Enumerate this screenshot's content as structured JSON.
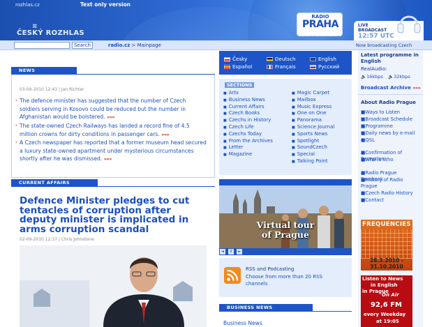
{
  "header": {
    "top_link": "rozhlas.cz",
    "text_only": "Text only version",
    "logo_text": "ČESKÝ ROZHLAS",
    "rp_line1": "RADIO",
    "rp_line2": "PRAHA",
    "rp_sub": "ČESKÝ ROZHLAS 7",
    "live_line1": "LIVE",
    "live_line2": "BROADCAST",
    "live_time": "12:57 UTC"
  },
  "search": {
    "button": "Search",
    "breadcrumb_home": "radio.cz",
    "breadcrumb_sep": ">",
    "breadcrumb_current": "Mainpage",
    "now_broadcasting": "Now broadcasting Czech"
  },
  "news": {
    "header": "NEWS",
    "meta_date": "03-09-2010 12:43",
    "meta_author": "Jan Richter",
    "more": "»»»",
    "items": [
      "The defence minister has suggested that the number of Czech soldiers serving in Kosovo could be reduced but the number in Afghanistan would be bolstered.",
      "The state-owned Czech Railways has landed a record fine of 4.5 million crowns for dirty conditions in passenger cars.",
      "A Czech newspaper has reported that a former museum head secured a luxury state-owned apartment under mysterious circumstances shortly after he was dismissed."
    ]
  },
  "current_affairs": {
    "header": "CURRENT AFFAIRS",
    "title": "Defence Minister pledges to cut tentacles of corruption after deputy minister is implicated in arms corruption scandal",
    "meta_date": "02-09-2010 12:37",
    "meta_author": "Chris Johnstone"
  },
  "languages": {
    "cesky": "Česky",
    "espanol": "Español",
    "deutsch": "Deutsch",
    "francais": "Français",
    "english": "English",
    "russian": "Русский"
  },
  "sections": {
    "header": "SECTIONS",
    "col1": [
      "Arts",
      "Business News",
      "Current Affairs",
      "Czech Books",
      "Czechs in History",
      "Czech Life",
      "Czechs Today",
      "From the Archives",
      "Letter",
      "Magazine"
    ],
    "col2": [
      "Magic Carpet",
      "Mailbox",
      "Music Express",
      "One on One",
      "Panorama",
      "Science Journal",
      "Sports News",
      "Spotlight",
      "SoundCzech",
      "Special",
      "Talking Point"
    ]
  },
  "virtual_tour": {
    "line1": "Virtual tour",
    "line2": "of Prague",
    "prev": "◄",
    "pause": "II",
    "next": "►"
  },
  "rss": {
    "title": "RSS and Podcasting",
    "desc": "Choose from more than 20 RSS channels"
  },
  "business_news": {
    "header": "BUSINESS NEWS",
    "link": "Business News"
  },
  "right": {
    "latest_title": "Latest programme in English",
    "realaudio": "RealAudio:",
    "kbps16": "16kbps",
    "kbps32": "32kbps",
    "archive": "Broadcast Archive",
    "archive_more": "»»»",
    "about_title": "About Radio Prague",
    "about_links": [
      "Ways to Listen",
      "Broadcast Schedule",
      "Programme",
      "Daily news by e-mail",
      "QSL",
      "Confirmation of Reception",
      "Who is Who",
      "Radio Prague Facebook",
      "History of Radio Prague",
      "Czech Radio History",
      "Contact"
    ],
    "freq_title": "FREQUENCIES",
    "freq_d1": "28.3.2010 -",
    "freq_d2": "31.10.2010",
    "onair_l1": "Listen to News",
    "onair_l2": "in English",
    "onair_l3": "in Prague",
    "onair_badge": "On Air",
    "onair_freq": "92,6 FM",
    "onair_l4": "every Weekday",
    "onair_l5": "at 19:05"
  }
}
